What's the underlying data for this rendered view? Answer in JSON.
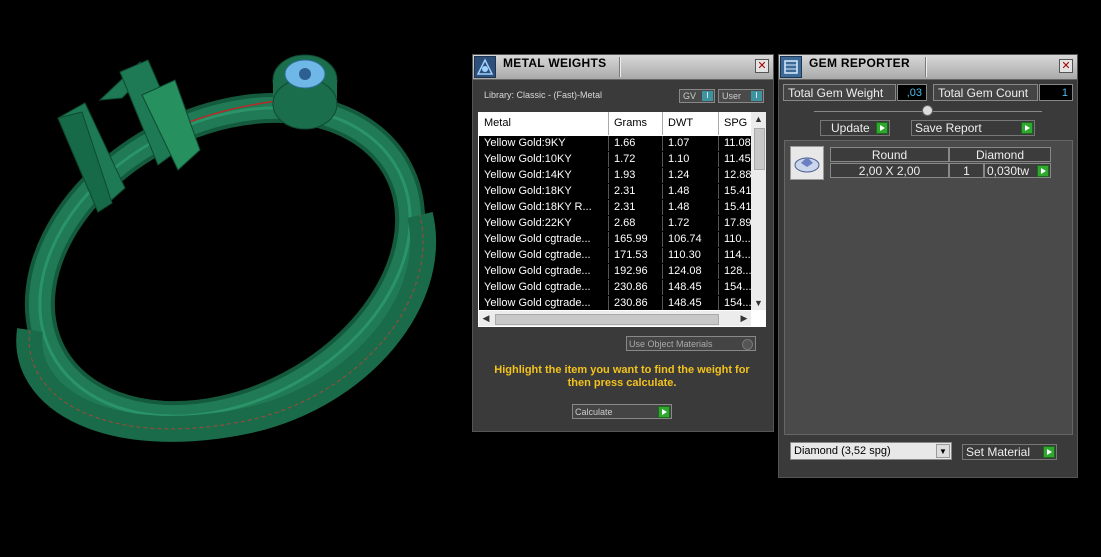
{
  "viewport": {
    "description_icon": "ring-3d-model"
  },
  "metal_weights": {
    "title": "METAL WEIGHTS",
    "library_label": "Library: Classic - (Fast)-Metal",
    "toggles": [
      {
        "label": "GV",
        "value": "I"
      },
      {
        "label": "User",
        "value": "I"
      }
    ],
    "columns": [
      "Metal",
      "Grams",
      "DWT",
      "SPG"
    ],
    "rows": [
      [
        "Yellow Gold:9KY",
        "1.66",
        "1.07",
        "11.08"
      ],
      [
        "Yellow Gold:10KY",
        "1.72",
        "1.10",
        "11.45"
      ],
      [
        "Yellow Gold:14KY",
        "1.93",
        "1.24",
        "12.88"
      ],
      [
        "Yellow Gold:18KY",
        "2.31",
        "1.48",
        "15.41"
      ],
      [
        "Yellow Gold:18KY R...",
        "2.31",
        "1.48",
        "15.41"
      ],
      [
        "Yellow Gold:22KY",
        "2.68",
        "1.72",
        "17.89"
      ],
      [
        "Yellow Gold cgtrade...",
        "165.99",
        "106.74",
        "110..."
      ],
      [
        "Yellow Gold cgtrade...",
        "171.53",
        "110.30",
        "114..."
      ],
      [
        "Yellow Gold cgtrade...",
        "192.96",
        "124.08",
        "128..."
      ],
      [
        "Yellow Gold cgtrade...",
        "230.86",
        "148.45",
        "154..."
      ],
      [
        "Yellow Gold cgtrade...",
        "230.86",
        "148.45",
        "154..."
      ]
    ],
    "use_object_materials": "Use Object Materials",
    "hint": "Highlight the item you want to find the weight for then press calculate.",
    "calculate": "Calculate"
  },
  "gem_reporter": {
    "title": "GEM REPORTER",
    "total_weight_label": "Total Gem Weight",
    "total_weight_value": ",03",
    "total_count_label": "Total Gem Count",
    "total_count_value": "1",
    "update": "Update",
    "save_report": "Save Report",
    "gem": {
      "shape": "Round",
      "material": "Diamond",
      "size": "2,00 X 2,00",
      "count": "1",
      "weight": "0,030tw"
    },
    "material_select": "Diamond     (3,52 spg)",
    "set_material": "Set Material"
  },
  "colors": {
    "ring_green": "#1f7a55",
    "hint_yellow": "#f2c21e",
    "value_blue": "#4fb9e6",
    "play_green": "#2fa82f"
  }
}
